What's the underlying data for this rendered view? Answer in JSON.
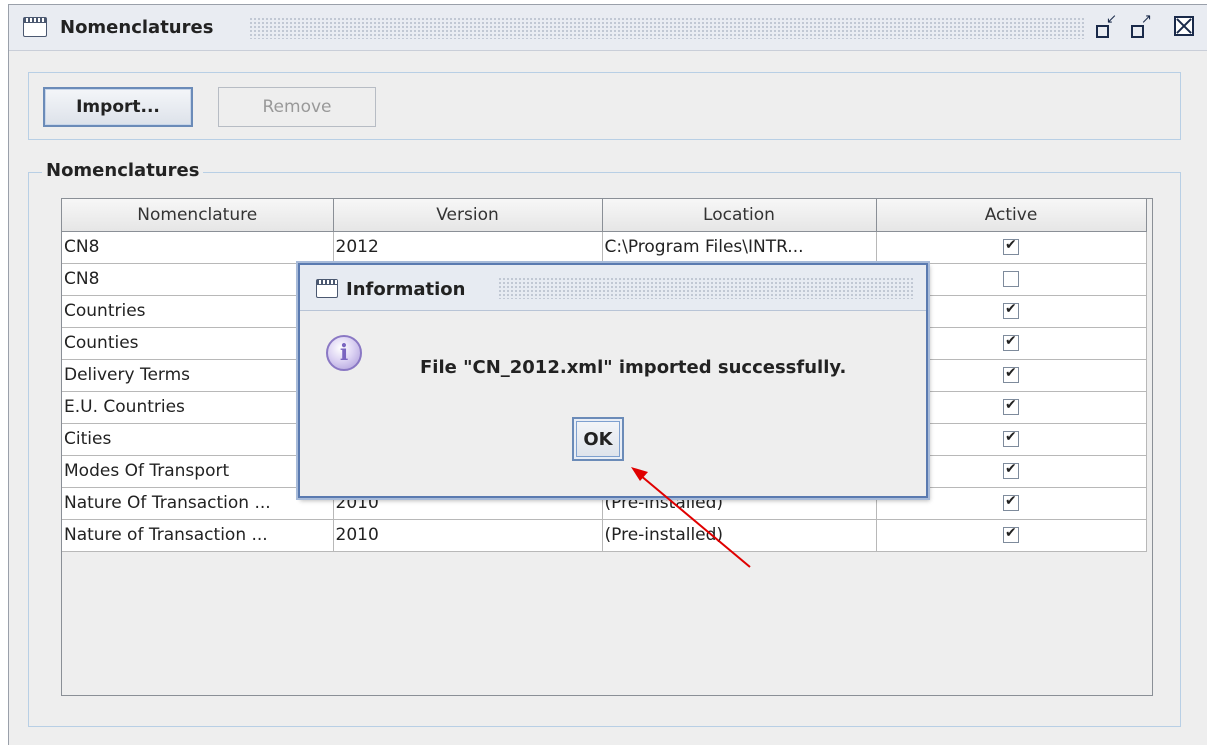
{
  "window": {
    "title": "Nomenclatures"
  },
  "toolbar": {
    "import_label": "Import...",
    "remove_label": "Remove"
  },
  "group": {
    "legend": "Nomenclatures"
  },
  "table": {
    "columns": [
      "Nomenclature",
      "Version",
      "Location",
      "Active"
    ],
    "rows": [
      {
        "nomenclature": "CN8",
        "version": "2012",
        "location": "C:\\Program Files\\INTR...",
        "active": true
      },
      {
        "nomenclature": "CN8",
        "version": "",
        "location": "",
        "active": false
      },
      {
        "nomenclature": "Countries",
        "version": "",
        "location": "",
        "active": true
      },
      {
        "nomenclature": "Counties",
        "version": "",
        "location": "",
        "active": true
      },
      {
        "nomenclature": "Delivery Terms",
        "version": "",
        "location": "",
        "active": true
      },
      {
        "nomenclature": "E.U. Countries",
        "version": "",
        "location": "",
        "active": true
      },
      {
        "nomenclature": "Cities",
        "version": "",
        "location": "",
        "active": true
      },
      {
        "nomenclature": "Modes Of Transport",
        "version": "",
        "location": "",
        "active": true
      },
      {
        "nomenclature": "Nature Of Transaction ...",
        "version": "2010",
        "location": "(Pre-installed)",
        "active": true
      },
      {
        "nomenclature": "Nature of Transaction ...",
        "version": "2010",
        "location": "(Pre-installed)",
        "active": true
      }
    ]
  },
  "dialog": {
    "title": "Information",
    "icon": "info-icon",
    "message": "File \"CN_2012.xml\" imported successfully.",
    "ok_label": "OK"
  },
  "colors": {
    "accent_border": "#5a7ab0",
    "annotation_arrow": "#e00000",
    "panel_border": "#b8cfe5"
  }
}
